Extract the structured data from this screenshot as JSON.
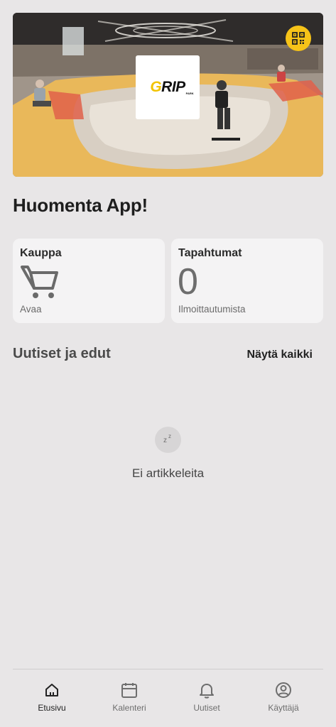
{
  "hero": {
    "logo_text_main": "GRIP",
    "logo_text_small": "PARK",
    "qr_icon": "qr-code-icon",
    "accent_color": "#f6c318"
  },
  "greeting": "Huomenta App!",
  "cards": {
    "shop": {
      "title": "Kauppa",
      "subtitle": "Avaa",
      "icon": "shopping-cart-icon"
    },
    "events": {
      "title": "Tapahtumat",
      "count": "0",
      "subtitle": "Ilmoittautumista"
    }
  },
  "news": {
    "title": "Uutiset ja edut",
    "show_all": "Näytä kaikki",
    "empty_icon": "sleep-zz-icon",
    "empty_text": "Ei artikkeleita"
  },
  "nav": {
    "items": [
      {
        "label": "Etusivu",
        "icon": "home-icon",
        "active": true
      },
      {
        "label": "Kalenteri",
        "icon": "calendar-icon",
        "active": false
      },
      {
        "label": "Uutiset",
        "icon": "bell-icon",
        "active": false
      },
      {
        "label": "Käyttäjä",
        "icon": "user-icon",
        "active": false
      }
    ]
  }
}
